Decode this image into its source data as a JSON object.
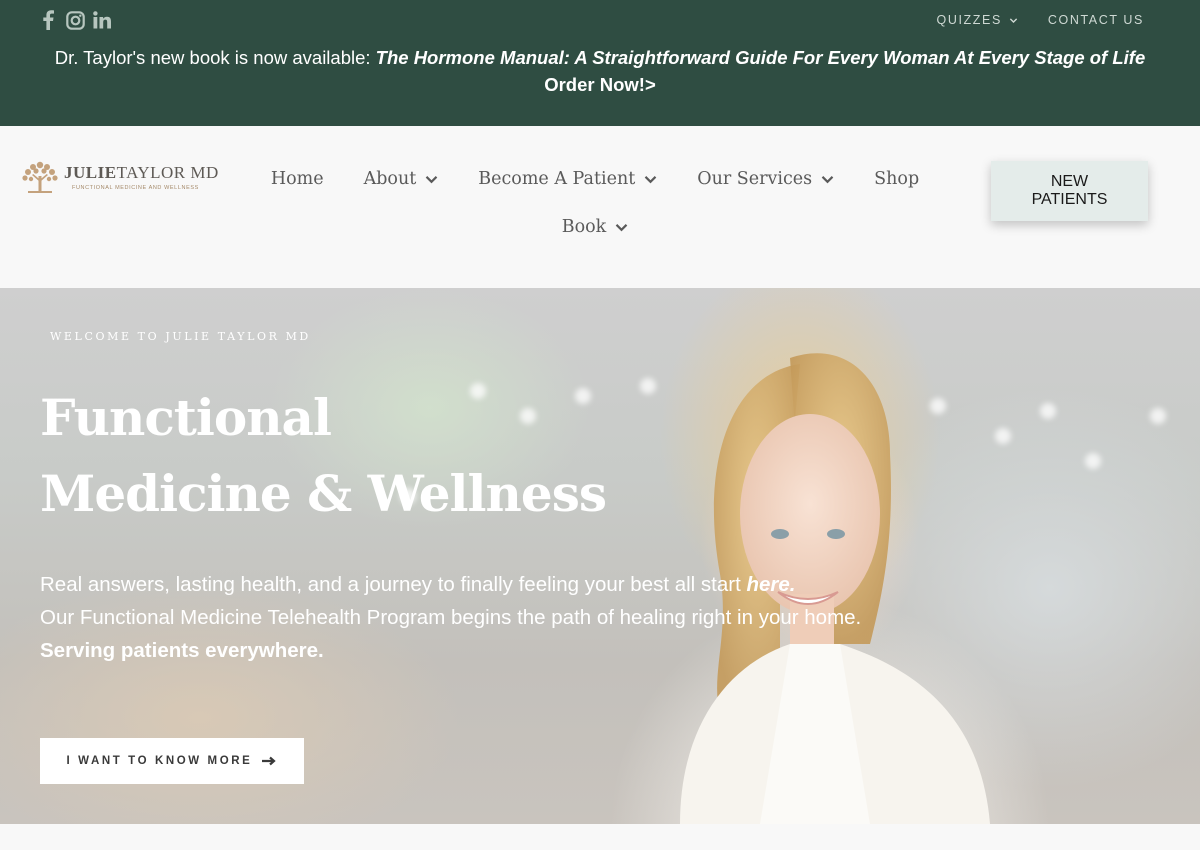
{
  "topbar": {
    "social": [
      {
        "icon": "facebook-icon"
      },
      {
        "icon": "instagram-icon"
      },
      {
        "icon": "linkedin-icon"
      }
    ],
    "links": [
      {
        "label": "QUIZZES",
        "has_dropdown": true
      },
      {
        "label": "CONTACT US",
        "has_dropdown": false
      }
    ],
    "announcement": {
      "prefix": "Dr. Taylor's new book is now available: ",
      "book_title": "The Hormone Manual: A Straightforward Guide For Every Woman At Every Stage of Life",
      "cta": "Order Now!>"
    },
    "colors": {
      "background": "#2f4d42",
      "text": "#ffffff"
    }
  },
  "nav": {
    "logo": {
      "name_bold": "JULIE",
      "name_rest": "TAYLOR MD",
      "tagline": "FUNCTIONAL MEDICINE AND WELLNESS",
      "icon": "tree-logo-icon"
    },
    "items": [
      {
        "label": "Home",
        "has_dropdown": false
      },
      {
        "label": "About",
        "has_dropdown": true
      },
      {
        "label": "Become A Patient",
        "has_dropdown": true
      },
      {
        "label": "Our Services",
        "has_dropdown": true
      },
      {
        "label": "Shop",
        "has_dropdown": false
      },
      {
        "label": "Book",
        "has_dropdown": true
      }
    ],
    "cta": {
      "line1": "NEW",
      "line2": "PATIENTS"
    },
    "colors": {
      "cta_background": "#e4ecea"
    }
  },
  "hero": {
    "eyebrow": "WELCOME TO JULIE TAYLOR MD",
    "title_line1": "Functional",
    "title_line2": "Medicine & Wellness",
    "copy_line1": "Real answers, lasting health, and a journey to finally feeling your best all start ",
    "copy_line1_emphasis": "here.",
    "copy_line2": "Our Functional Medicine Telehealth Program begins the path of healing right in your home.",
    "copy_line3": "Serving patients everywhere.",
    "button_label": "I WANT TO KNOW MORE",
    "button_icon": "arrow-right-icon"
  }
}
